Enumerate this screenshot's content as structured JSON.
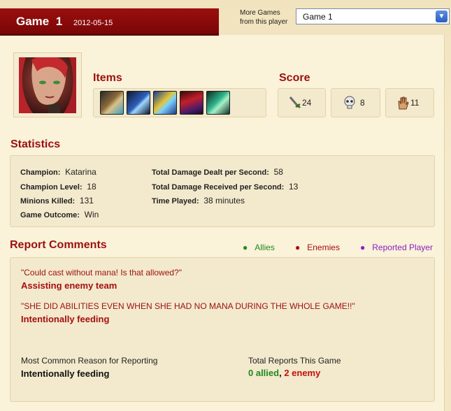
{
  "header": {
    "title": "Game",
    "game_number": "1",
    "date": "2012-05-15"
  },
  "game_selector": {
    "label": "More Games from this player",
    "selected": "Game 1"
  },
  "sections": {
    "items": "Items",
    "score": "Score",
    "statistics": "Statistics",
    "report_comments": "Report Comments"
  },
  "score": {
    "kills": "24",
    "deaths": "8",
    "assists": "11"
  },
  "statistics": {
    "champion_label": "Champion:",
    "champion": "Katarina",
    "level_label": "Champion Level:",
    "level": "18",
    "minions_label": "Minions Killed:",
    "minions": "131",
    "outcome_label": "Game Outcome:",
    "outcome": "Win",
    "dmg_dealt_label": "Total Damage Dealt per Second:",
    "dmg_dealt": "58",
    "dmg_received_label": "Total Damage Received per Second:",
    "dmg_received": "13",
    "time_label": "Time Played:",
    "time": "38 minutes"
  },
  "legend": {
    "allies": "Allies",
    "enemies": "Enemies",
    "reported": "Reported Player",
    "colors": {
      "allies": "#1f8a1f",
      "enemies": "#a50f0f",
      "reported": "#8a1fc4"
    }
  },
  "comments": [
    {
      "quote": "\"Could cast without mana! Is that allowed?\"",
      "reason": "Assisting enemy team"
    },
    {
      "quote": "\"SHE DID ABILITIES EVEN WHEN SHE HAD NO MANA DURING THE WHOLE GAME!!\"",
      "reason": "Intentionally feeding"
    }
  ],
  "summary": {
    "common_reason_label": "Most Common Reason for Reporting",
    "common_reason": "Intentionally feeding",
    "total_reports_label": "Total Reports This Game",
    "allied": "0 allied",
    "separator": ", ",
    "enemy": "2 enemy"
  }
}
